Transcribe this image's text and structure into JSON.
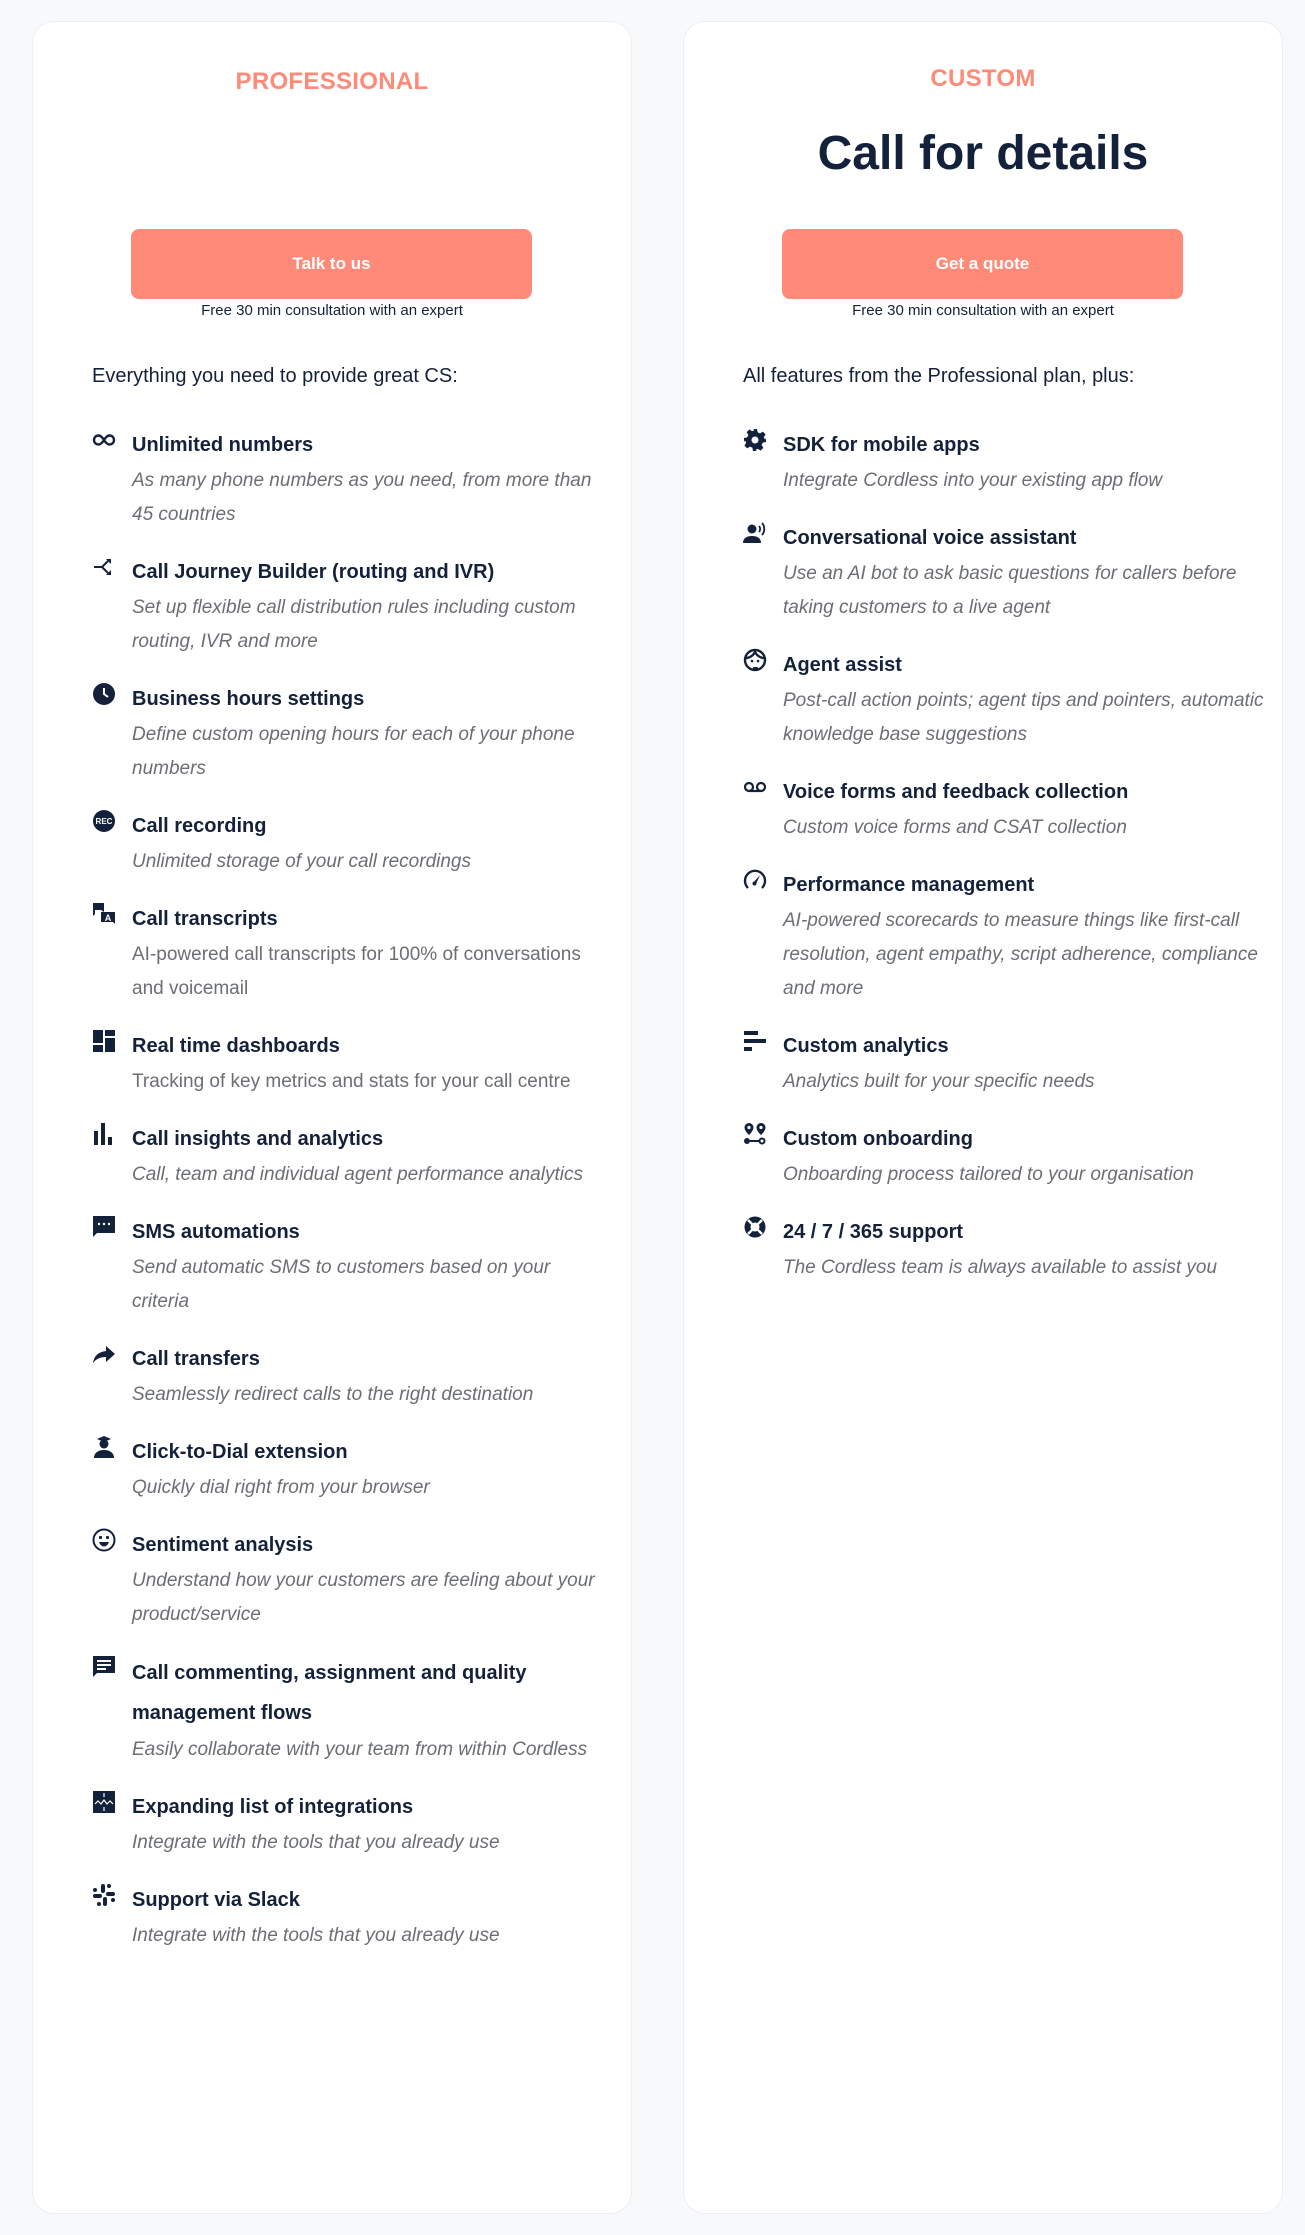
{
  "colors": {
    "accent": "#ff8a78",
    "text": "#14213a",
    "muted": "#6b6e73",
    "background": "#f8f9fb"
  },
  "plans": [
    {
      "name": "PROFESSIONAL",
      "price": "",
      "cta_label": "Talk to us",
      "cta_note": "Free 30 min consultation with an expert",
      "intro": "Everything you need to provide great CS:",
      "features": [
        {
          "icon": "infinity-icon",
          "title": "Unlimited numbers",
          "description": "As many phone numbers as you need, from more than 45 countries"
        },
        {
          "icon": "call-split-icon",
          "title": "Call Journey Builder (routing and IVR)",
          "description": "Set up flexible call distribution rules including custom routing, IVR and more"
        },
        {
          "icon": "clock-icon",
          "title": "Business hours settings",
          "description": "Define custom opening hours for each of your phone numbers"
        },
        {
          "icon": "rec-icon",
          "title": "Call recording",
          "description": "Unlimited storage of your call recordings"
        },
        {
          "icon": "translate-icon",
          "title": "Call transcripts",
          "description": "AI-powered call transcripts for 100% of conversations and voicemail"
        },
        {
          "icon": "dashboard-icon",
          "title": "Real time dashboards",
          "description": "Tracking of key metrics and stats for your call centre"
        },
        {
          "icon": "bar-chart-icon",
          "title": "Call insights and analytics",
          "description": "Call, team and individual agent performance analytics"
        },
        {
          "icon": "sms-icon",
          "title": "SMS automations",
          "description": "Send automatic SMS to customers based on your criteria"
        },
        {
          "icon": "forward-arrow-icon",
          "title": "Call transfers",
          "description": "Seamlessly redirect calls to the right destination"
        },
        {
          "icon": "agent-icon",
          "title": "Click-to-Dial extension",
          "description": "Quickly dial right from your browser"
        },
        {
          "icon": "smiley-icon",
          "title": "Sentiment analysis",
          "description": "Understand how your customers are feeling about your product/service"
        },
        {
          "icon": "comment-icon",
          "title": "Call commenting, assignment and quality management flows",
          "description": "Easily collaborate with your team from within Cordless"
        },
        {
          "icon": "puzzle-icon",
          "title": "Expanding list of integrations",
          "description": "Integrate with the tools that you already use"
        },
        {
          "icon": "slack-icon",
          "title": "Support via Slack",
          "description": "Integrate with the tools that you already use"
        }
      ]
    },
    {
      "name": "CUSTOM",
      "price": "Call for details",
      "cta_label": "Get a quote",
      "cta_note": "Free 30 min consultation with an expert",
      "intro": "All features from the Professional plan, plus:",
      "features": [
        {
          "icon": "gear-icon",
          "title": "SDK for mobile apps",
          "description": "Integrate Cordless into your existing app flow"
        },
        {
          "icon": "voice-person-icon",
          "title": "Conversational voice assistant",
          "description": "Use an AI bot to ask basic questions for callers before taking customers to a live agent"
        },
        {
          "icon": "support-agent-icon",
          "title": "Agent assist",
          "description": "Post-call action points; agent tips and pointers, automatic knowledge base suggestions"
        },
        {
          "icon": "voicemail-icon",
          "title": "Voice forms and feedback collection",
          "description": "Custom voice forms and CSAT collection"
        },
        {
          "icon": "speedometer-icon",
          "title": "Performance management",
          "description": "AI-powered scorecards to measure things like first-call resolution, agent empathy, script adherence, compliance and more"
        },
        {
          "icon": "horizontal-bars-icon",
          "title": "Custom analytics",
          "description": "Analytics built for your specific needs"
        },
        {
          "icon": "route-pins-icon",
          "title": "Custom onboarding",
          "description": "Onboarding process tailored to your organisation"
        },
        {
          "icon": "lifebuoy-icon",
          "title": "24 / 7 / 365 support",
          "description": "The Cordless team is always available to assist you"
        }
      ]
    }
  ]
}
